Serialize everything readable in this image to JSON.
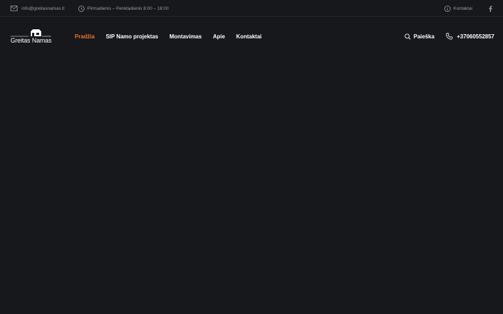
{
  "topbar": {
    "email": {
      "icon": "mail-icon",
      "text": "info@greitasnamas.lt"
    },
    "hours": {
      "icon": "clock-icon",
      "text": "Pirmadienis – Penktadienis 8:00 – 18:00"
    },
    "contacts": {
      "icon": "info-icon",
      "text": "Kontaktai"
    },
    "social": {
      "icon": "facebook-icon"
    }
  },
  "header": {
    "logo": {
      "icon": "house-icon",
      "text": "Greitas Namas"
    },
    "nav": [
      {
        "label": "Pradžia",
        "active": true
      },
      {
        "label": "SIP Namo projektas",
        "active": false
      },
      {
        "label": "Montavimas",
        "active": false
      },
      {
        "label": "Apie",
        "active": false
      },
      {
        "label": "Kontaktai",
        "active": false
      }
    ],
    "search": {
      "icon": "search-icon",
      "label": "Paieška"
    },
    "phone": {
      "icon": "phone-icon",
      "number": "+37060552857"
    }
  },
  "colors": {
    "background": "#17181c",
    "accent": "#e8762c",
    "muted_text": "#9b9ca3",
    "text": "#ffffff"
  }
}
